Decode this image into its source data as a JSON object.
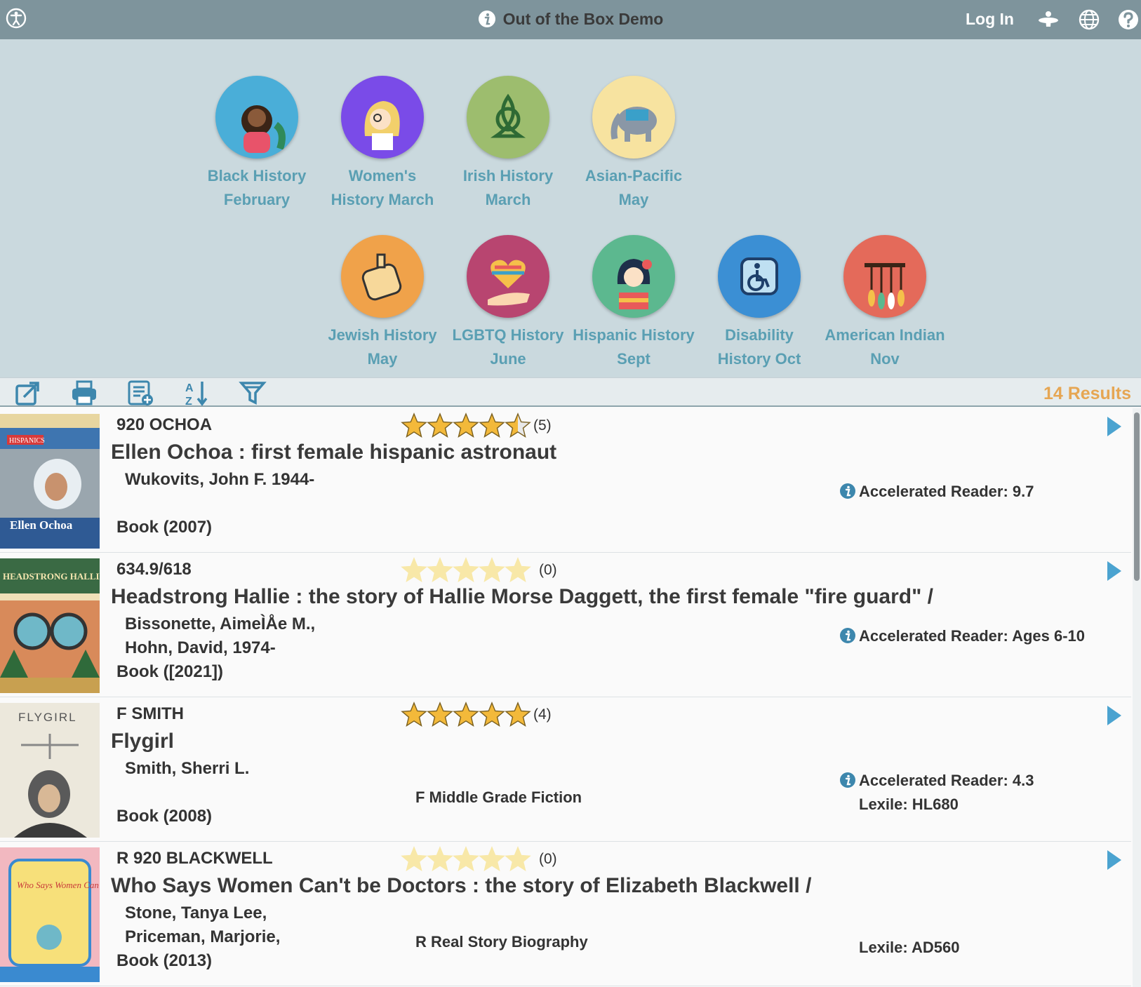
{
  "topbar": {
    "title": "Out of the Box Demo",
    "login": "Log In",
    "icons": [
      "accessibility-icon",
      "info-icon",
      "app-icon",
      "globe-icon",
      "help-icon"
    ]
  },
  "categories": [
    {
      "line1": "Black History",
      "line2": "February",
      "badge": "BLACK HISTORY",
      "color": "#4aaed8"
    },
    {
      "line1": "Women's",
      "line2": "History March",
      "badge": "WOMENS HISTORY",
      "color": "#7a4be8"
    },
    {
      "line1": "Irish History",
      "line2": "March",
      "badge": "IRISH HISTORY",
      "color": "#9dbd6e"
    },
    {
      "line1": "Asian-Pacific",
      "line2": "May",
      "badge": "ASIAN-PACIFIC HISTORY",
      "color": "#f7e3a0"
    },
    {
      "line1": "Jewish History",
      "line2": "May",
      "badge": "JEWISH HISTORY",
      "color": "#f0a24a"
    },
    {
      "line1": "LGBTQ History",
      "line2": "June",
      "badge": "LGBTQ HISTORY",
      "color": "#b84570"
    },
    {
      "line1": "Hispanic History",
      "line2": "Sept",
      "badge": "HISPANIC HISTORY",
      "color": "#5cb88f"
    },
    {
      "line1": "Disability",
      "line2": "History Oct",
      "badge": "DISABILITY HISTORY",
      "color": "#3b8fd4"
    },
    {
      "line1": "American Indian",
      "line2": "Nov",
      "badge": "AMERICAN INDIAN HISTORY",
      "color": "#e46a5a"
    }
  ],
  "toolbar": {
    "icons": [
      "export-icon",
      "print-icon",
      "add-to-list-icon",
      "sort-az-icon",
      "filter-icon"
    ],
    "results": "14 Results"
  },
  "results": [
    {
      "callno": "920 OCHOA",
      "rating": 4.5,
      "rating_count": "(5)",
      "title": "Ellen Ochoa : first female hispanic astronaut",
      "authors": [
        "Wukovits, John F. 1944-"
      ],
      "format": "Book (2007)",
      "genre": "",
      "ar": "Accelerated Reader: 9.7",
      "lexile": "",
      "cover_text": "Ellen Ochoa",
      "cover_top": "HISPANICS"
    },
    {
      "callno": "634.9/618",
      "rating": 0,
      "rating_count": "(0)",
      "title": "Headstrong Hallie : the story of Hallie Morse Daggett, the first female \"fire guard\" /",
      "authors": [
        "Bissonette, AimeÌÅe M.,",
        "Hohn, David, 1974-"
      ],
      "format": "Book ([2021])",
      "genre": "",
      "ar": "Accelerated Reader: Ages 6-10",
      "lexile": "",
      "cover_text": "HEADSTRONG HALLIE!",
      "cover_top": ""
    },
    {
      "callno": "F SMITH",
      "rating": 5,
      "rating_count": "(4)",
      "title": "Flygirl",
      "authors": [
        "Smith, Sherri L."
      ],
      "format": "Book (2008)",
      "genre": "F Middle Grade Fiction",
      "ar": "Accelerated Reader: 4.3",
      "lexile": "Lexile: HL680",
      "cover_text": "FLYGIRL",
      "cover_top": ""
    },
    {
      "callno": "R 920 BLACKWELL",
      "rating": 0,
      "rating_count": "(0)",
      "title": "Who Says Women Can't be Doctors : the story of Elizabeth Blackwell /",
      "authors": [
        "Stone, Tanya Lee,",
        "Priceman, Marjorie,"
      ],
      "format": "Book (2013)",
      "genre": "R Real Story Biography",
      "ar": "",
      "lexile": "Lexile: AD560",
      "cover_text": "Who Says Women Can't Be DOCTORS?",
      "cover_top": ""
    }
  ]
}
